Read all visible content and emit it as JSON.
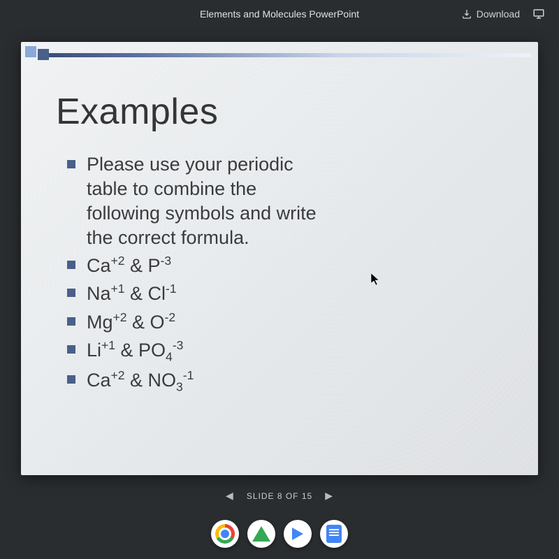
{
  "header": {
    "title": "Elements and Molecules PowerPoint",
    "download_label": "Download"
  },
  "slide": {
    "title": "Examples",
    "bullets": [
      {
        "html": "Please use your periodic table to combine the following symbols and write the correct formula."
      },
      {
        "html": "Ca<sup>+2</sup> & P<sup>-3</sup>"
      },
      {
        "html": "Na<sup>+1</sup> & Cl<sup>-1</sup>"
      },
      {
        "html": "Mg<sup>+2</sup> & O<sup>-2</sup>"
      },
      {
        "html": "Li<sup>+1</sup> & PO<sub>4</sub><sup>-3</sup>"
      },
      {
        "html": "Ca<sup>+2</sup> & NO<sub>3</sub><sup>-1</sup>"
      }
    ]
  },
  "nav": {
    "counter": "SLIDE 8 OF 15"
  }
}
